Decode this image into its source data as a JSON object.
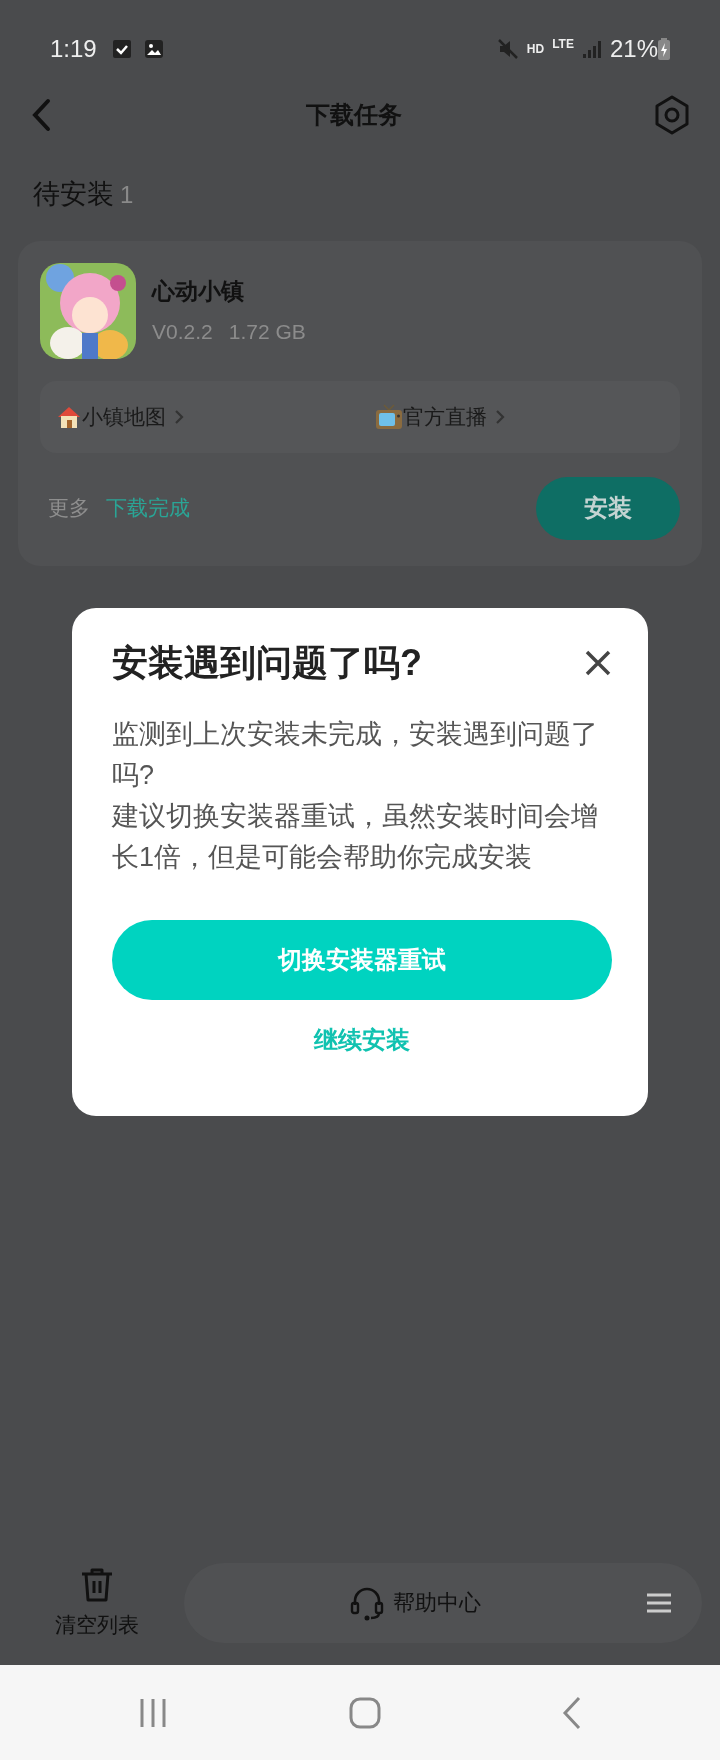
{
  "status_bar": {
    "time": "1:19",
    "network": "HD",
    "signal_type": "LTE",
    "battery": "21%"
  },
  "header": {
    "title": "下载任务"
  },
  "section": {
    "title": "待安装",
    "count": "1"
  },
  "tasks": [
    {
      "name": "心动小镇",
      "version": "V0.2.2",
      "size": "1.72 GB",
      "links": [
        {
          "label": "小镇地图",
          "kind": "house"
        },
        {
          "label": "官方直播",
          "kind": "tv"
        }
      ],
      "more": "更多",
      "status": "下载完成",
      "action": "安装"
    }
  ],
  "bottom_bar": {
    "clear": "清空列表",
    "help": "帮助中心"
  },
  "dialog": {
    "title": "安装遇到问题了吗?",
    "lines": [
      "监测到上次安装未完成，安装遇到问题了吗?",
      "建议切换安装器重试，虽然安装时间会增长1倍，但是可能会帮助你完成安装"
    ],
    "primary": "切换安装器重试",
    "secondary": "继续安装"
  }
}
